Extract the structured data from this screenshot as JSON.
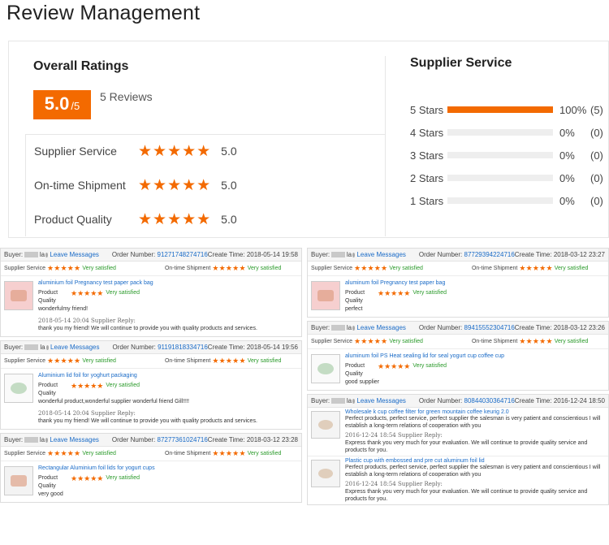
{
  "page_title": "Review Management",
  "overall": {
    "title": "Overall Ratings",
    "score": "5.0",
    "score_max": "/5",
    "reviews": "5 Reviews",
    "categories": [
      {
        "label": "Supplier Service",
        "stars": "★★★★★",
        "value": "5.0"
      },
      {
        "label": "On-time Shipment",
        "stars": "★★★★★",
        "value": "5.0"
      },
      {
        "label": "Product Quality",
        "stars": "★★★★★",
        "value": "5.0"
      }
    ]
  },
  "supplier_service": {
    "title": "Supplier Service",
    "rows": [
      {
        "label": "5 Stars",
        "fill": 1.0,
        "pct": "100%",
        "count": "(5)"
      },
      {
        "label": "4 Stars",
        "fill": 0,
        "pct": "0%",
        "count": "(0)"
      },
      {
        "label": "3 Stars",
        "fill": 0,
        "pct": "0%",
        "count": "(0)"
      },
      {
        "label": "2 Stars",
        "fill": 0,
        "pct": "0%",
        "count": "(0)"
      },
      {
        "label": "1 Stars",
        "fill": 0,
        "pct": "0%",
        "count": "(0)"
      }
    ]
  },
  "colors": {
    "accent": "#f36a00",
    "link": "#1a6bc7",
    "satisfied": "#2a9a2a"
  },
  "labels": {
    "buyer": "Buyer:",
    "leave_messages": "Leave Messages",
    "order_number": "Order Number:",
    "create_time": "Create Time:",
    "supplier_service": "Supplier Service",
    "ontime_shipment": "On-time Shipment",
    "very_satisfied": "Very satisfied",
    "product": "Product",
    "quality": "Quality",
    "stars": "★★★★★"
  },
  "reviews_left": [
    {
      "buyer_suffix": "la",
      "order": "91271748274716",
      "time": "2018-05-14 19:58",
      "product_name": "aluminium foil Pregnancy test paper pack bag",
      "comment": "wonderfulmy friend!",
      "reply_meta": "2018-05-14 20:04  Supplier Reply:",
      "reply": "thank you my friend! We will continue to provide you with quality products and services."
    },
    {
      "buyer_suffix": "la",
      "order": "91191818334716",
      "time": "2018-05-14 19:56",
      "product_name": "Aluminium lid foil for yoghurt packaging",
      "comment": "wonderful product,wonderful supplier wonderful friend Gill!!!!",
      "reply_meta": "2018-05-14 20:04  Supplier Reply:",
      "reply": "thank you my friend! We will continue to provide you with quality products and services."
    },
    {
      "buyer_suffix": "la",
      "order": "87277361024716",
      "time": "2018-03-12 23:28",
      "product_name": "Rectangular Aluminium foil lids for yogurt cups",
      "comment": "very good"
    }
  ],
  "reviews_right": [
    {
      "buyer_suffix": "la",
      "order": "87729394224716",
      "time": "2018-03-12 23:27",
      "product_name": "aluminum foil Pregnancy test paper bag",
      "comment": "perfect"
    },
    {
      "buyer_suffix": "la",
      "order": "89415552304716",
      "time": "2018-03-12 23:26",
      "product_name": "aluminum foil PS Heat sealing lid for seal yogurt cup coffee cup",
      "comment": "good supplier"
    },
    {
      "buyer_suffix": "la",
      "order": "80844030364716",
      "time": "2016-12-24 18:50",
      "items": [
        {
          "product_name": "Wholesale k cup coffee filter for green mountain coffee keurig 2.0",
          "comment": "Perfect products, perfect service, perfect supplier the salesman is very patient and conscientious I will establish a long-term relations of cooperation with you",
          "reply_meta": "2016-12-24 18:54  Supplier Reply:",
          "reply": "Express thank you very much for your evaluation. We will continue to provide quality service and products for you."
        },
        {
          "product_name": "Plastic cup with embossed and pre cut aluminum foil lid",
          "comment": "Perfect products, perfect service, perfect supplier the salesman is very patient and conscientious I will establish a long-term relations of cooperation with you",
          "reply_meta": "2016-12-24 18:54  Supplier Reply:",
          "reply": "Express thank you very much for your evaluation. We will continue to provide quality service and products for you."
        }
      ]
    }
  ]
}
